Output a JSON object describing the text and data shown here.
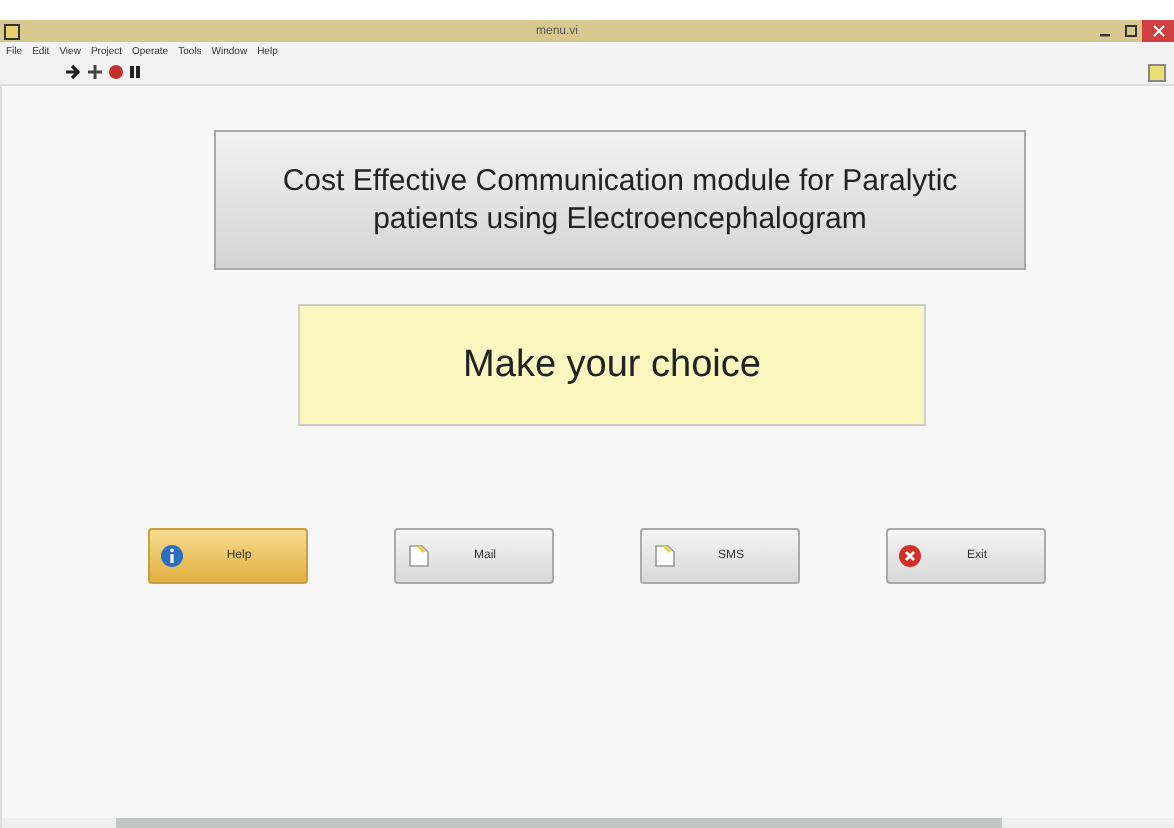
{
  "window": {
    "title": "menu.vi"
  },
  "menu": [
    "File",
    "Edit",
    "View",
    "Project",
    "Operate",
    "Tools",
    "Window",
    "Help"
  ],
  "heading": "Cost Effective Communication module for Paralytic patients using Electroencephalogram",
  "prompt": "Make your choice",
  "buttons": [
    {
      "label": "Help",
      "kind": "info",
      "selected": true
    },
    {
      "label": "Mail",
      "kind": "document",
      "selected": false
    },
    {
      "label": "SMS",
      "kind": "document",
      "selected": false
    },
    {
      "label": "Exit",
      "kind": "error",
      "selected": false
    }
  ]
}
